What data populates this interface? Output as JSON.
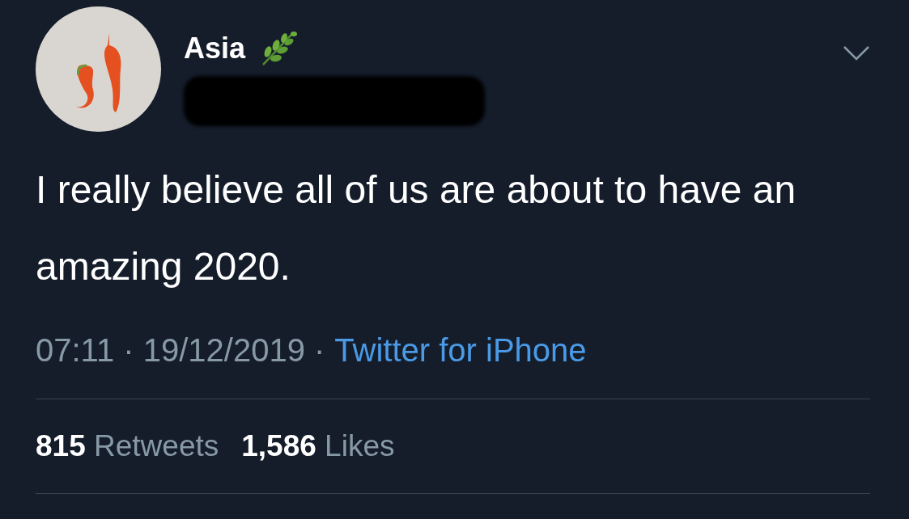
{
  "author": {
    "name": "Asia",
    "handle_redacted": true
  },
  "tweet": {
    "text": "I really believe all of us are about to have an amazing 2020."
  },
  "meta": {
    "timestamp": "07:11 · 19/12/2019 ·",
    "source": "Twitter for iPhone"
  },
  "stats": [
    {
      "count": "815",
      "label": "Retweets"
    },
    {
      "count": "1,586",
      "label": "Likes"
    }
  ]
}
